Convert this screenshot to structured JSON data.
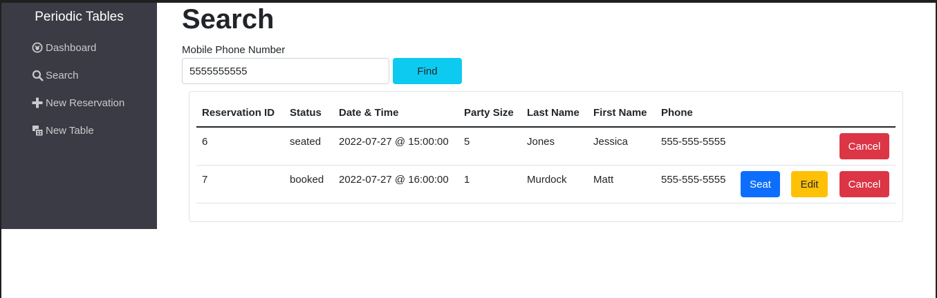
{
  "sidebar": {
    "brand": "Periodic Tables",
    "items": [
      {
        "label": "Dashboard",
        "icon": "dashboard-icon"
      },
      {
        "label": "Search",
        "icon": "search-icon"
      },
      {
        "label": "New Reservation",
        "icon": "plus-icon"
      },
      {
        "label": "New Table",
        "icon": "table-icon"
      }
    ]
  },
  "main": {
    "title": "Search",
    "search": {
      "label": "Mobile Phone Number",
      "value": "5555555555",
      "button": "Find"
    }
  },
  "table": {
    "headers": [
      "Reservation ID",
      "Status",
      "Date & Time",
      "Party Size",
      "Last Name",
      "First Name",
      "Phone"
    ],
    "rows": [
      {
        "id": "6",
        "status": "seated",
        "datetime": "2022-07-27 @ 15:00:00",
        "party_size": "5",
        "last_name": "Jones",
        "first_name": "Jessica",
        "phone": "555-555-5555",
        "actions": {
          "cancel": "Cancel"
        }
      },
      {
        "id": "7",
        "status": "booked",
        "datetime": "2022-07-27 @ 16:00:00",
        "party_size": "1",
        "last_name": "Murdock",
        "first_name": "Matt",
        "phone": "555-555-5555",
        "actions": {
          "seat": "Seat",
          "edit": "Edit",
          "cancel": "Cancel"
        }
      }
    ]
  },
  "colors": {
    "sidebar_bg": "#3a3b44",
    "find": "#0dcaf0",
    "seat": "#0d6efd",
    "edit": "#ffc107",
    "cancel": "#dc3545"
  }
}
